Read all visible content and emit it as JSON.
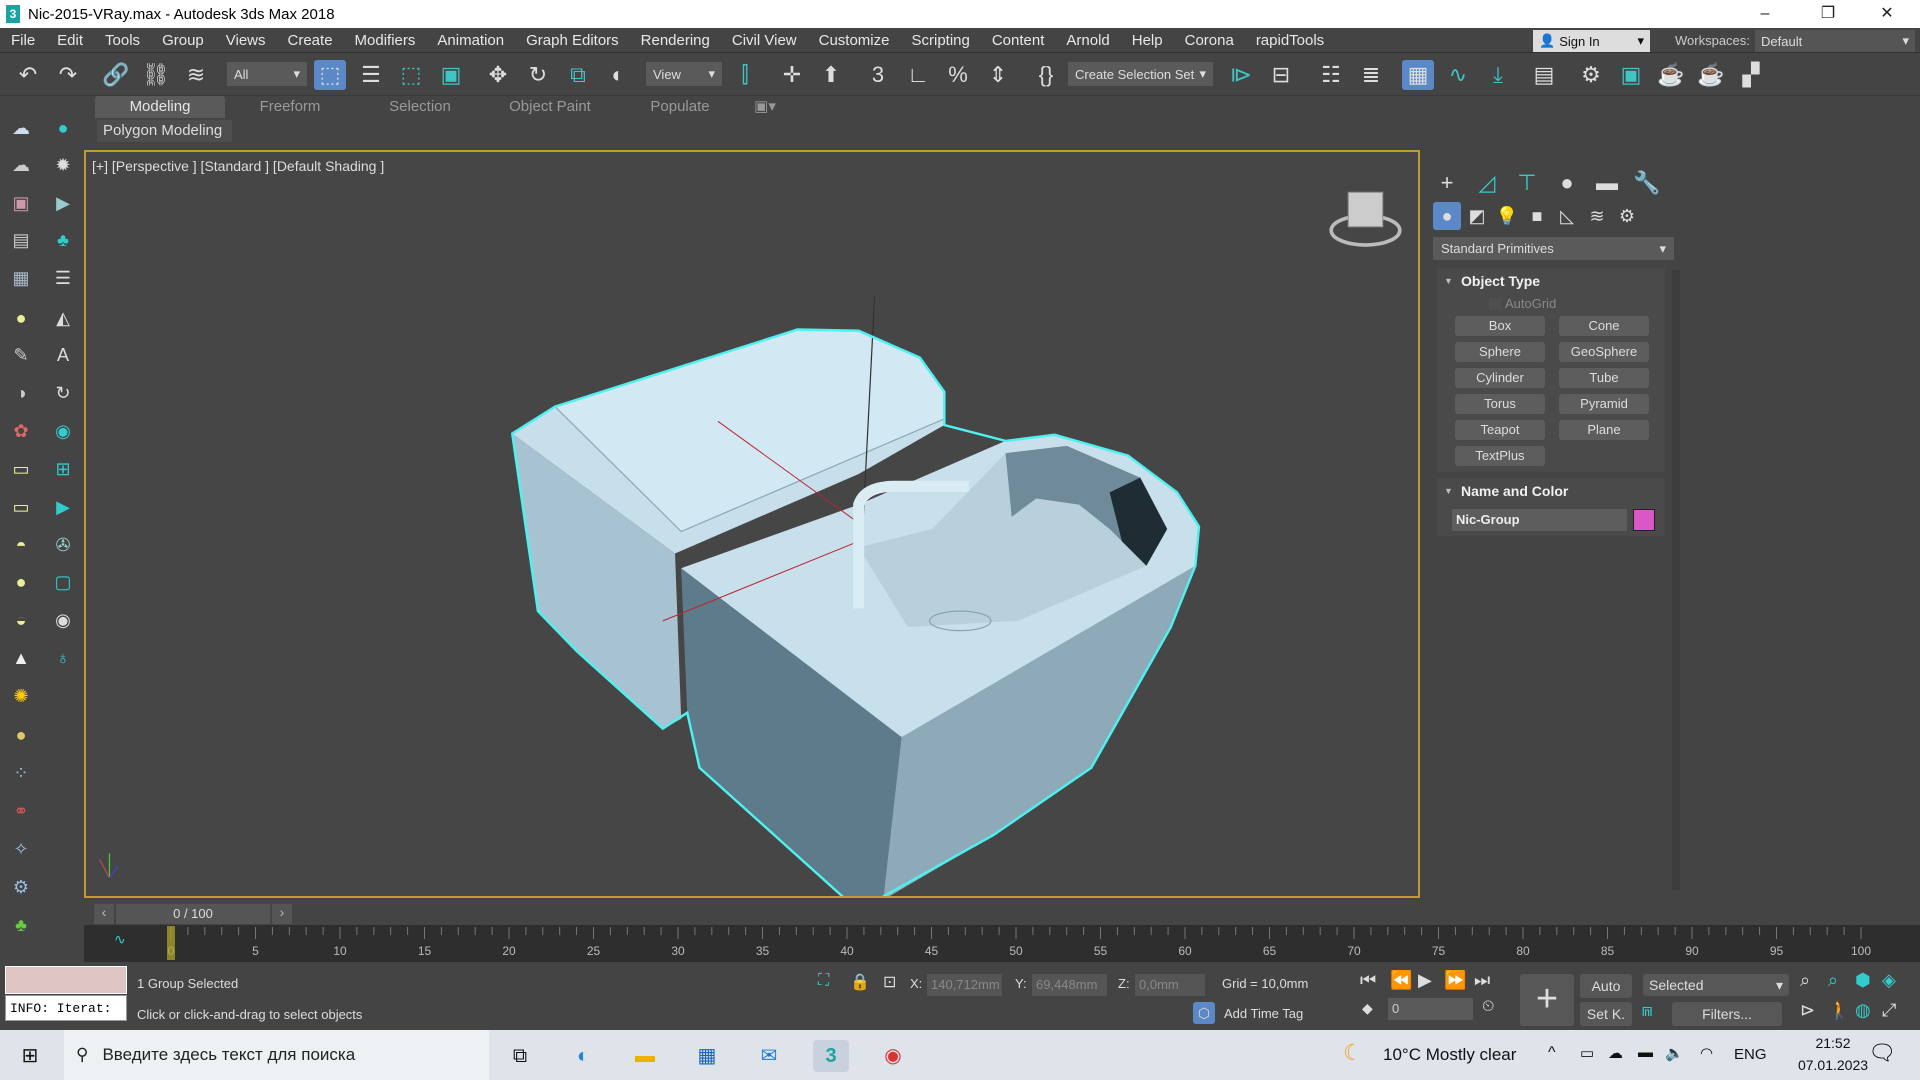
{
  "window": {
    "title": "Nic-2015-VRay.max - Autodesk 3ds Max 2018",
    "app_icon_text": "3"
  },
  "menu": [
    "File",
    "Edit",
    "Tools",
    "Group",
    "Views",
    "Create",
    "Modifiers",
    "Animation",
    "Graph Editors",
    "Rendering",
    "Civil View",
    "Customize",
    "Scripting",
    "Content",
    "Arnold",
    "Help",
    "Corona",
    "rapidTools"
  ],
  "account": {
    "sign_in": "Sign In",
    "workspaces_label": "Workspaces:",
    "workspace": "Default"
  },
  "toolbar": {
    "selection_filter": "All",
    "ref_coord": "View",
    "named_selection": "Create Selection Set"
  },
  "ribbon": {
    "tabs": [
      "Modeling",
      "Freeform",
      "Selection",
      "Object Paint",
      "Populate"
    ],
    "active_panel": "Polygon Modeling"
  },
  "viewport": {
    "label": "[+] [Perspective ] [Standard ] [Default Shading ]",
    "colors": {
      "selection": "#4ff0f0",
      "model": "#c8e2ee",
      "border": "#c29a2b"
    }
  },
  "command_panel": {
    "category": "Standard Primitives",
    "object_type": {
      "title": "Object Type",
      "autogrid": "AutoGrid",
      "buttons": [
        "Box",
        "Cone",
        "Sphere",
        "GeoSphere",
        "Cylinder",
        "Tube",
        "Torus",
        "Pyramid",
        "Teapot",
        "Plane",
        "TextPlus"
      ]
    },
    "name_color": {
      "title": "Name and Color",
      "name": "Nic-Group",
      "color": "#d858c8"
    }
  },
  "timeline": {
    "position": "0 / 100",
    "current": 0,
    "end": 100,
    "tick_labels": [
      0,
      5,
      10,
      15,
      20,
      25,
      30,
      35,
      40,
      45,
      50,
      55,
      60,
      65,
      70,
      75,
      80,
      85,
      90,
      95,
      100
    ]
  },
  "status": {
    "selection": "1 Group Selected",
    "prompt": "Click or click-and-drag to select objects",
    "maxscript": "INFO: Iterat:",
    "x_label": "X:",
    "x": "140,712mm",
    "y_label": "Y:",
    "y": "69,448mm",
    "z_label": "Z:",
    "z": "0,0mm",
    "grid": "Grid = 10,0mm",
    "add_time_tag": "Add Time Tag",
    "frame": "0",
    "auto": "Auto",
    "set_key": "Set K.",
    "key_filter": "Selected",
    "filters": "Filters..."
  },
  "taskbar": {
    "search_placeholder": "Введите здесь текст для поиска",
    "weather": "10°C  Mostly clear",
    "lang": "ENG",
    "time": "21:52",
    "date": "07.01.2023"
  }
}
